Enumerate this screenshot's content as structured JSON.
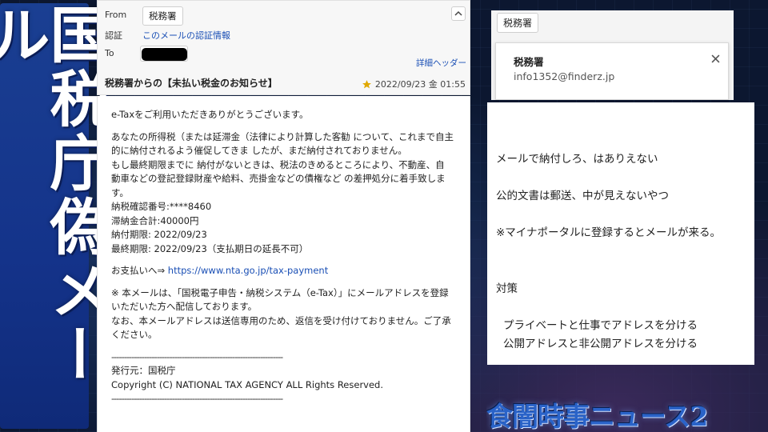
{
  "banner": {
    "text": "国税庁偽メール"
  },
  "mail_header": {
    "from_label": "From",
    "from_value": "税務署",
    "auth_label": "認証",
    "auth_link": "このメールの認証情報",
    "to_label": "To",
    "details_link": "詳細ヘッダー",
    "subject": "税務署からの【未払い税金のお知らせ】",
    "date": "2022/09/23 金 01:55",
    "collapse_icon": "chevron-up-icon",
    "star_icon": "star-icon",
    "star_color": "#e0a800"
  },
  "mail_body": {
    "greeting": "e-Taxをご利用いただきありがとうございます。",
    "para1": "あなたの所得税（または延滞金（法律により計算した客勧 について、これまで自主的に納付されるよう催促してきま したが、まだ納付されておりません。",
    "para2": "もし最終期限までに 納付がないときは、税法のきめるところにより、不動産、自 動車などの登記登録財産や給料、売掛金などの債権など の差押処分に着手致します。",
    "confirm_no": "納税確認番号:****8460",
    "total": "滞納金合計:40000円",
    "due": "納付期限: 2022/09/23",
    "final_due": "最終期限: 2022/09/23（支払期日の延長不可）",
    "pay_prefix": "お支払いへ⇒ ",
    "pay_link": "https://www.nta.go.jp/tax-payment",
    "note1": "※ 本メールは、「国税電子申告・納税システム（e-Tax）」にメールアドレスを登録いただいた方へ配信しております。",
    "note2": "なお、本メールアドレスは送信専用のため、返信を受け付けておりません。ご了承ください。",
    "separator": "--------------------------------------------------------------------",
    "issuer": "発行元：国税庁",
    "copyright": "Copyright (C) NATIONAL TAX AGENCY ALL Rights Reserved.",
    "separator2": "--------------------------------------------------------------------"
  },
  "sender_popup": {
    "chip": "税務署",
    "name": "税務署",
    "email": "info1352@finderz.jp",
    "close_icon": "close-icon"
  },
  "notes": {
    "line1": "メールで納付しろ、はありえない",
    "line2": "公的文書は郵送、中が見えないやつ",
    "line3": "※マイナポータルに登録するとメールが来る。",
    "heading": "対策",
    "tip1": "プライベートと仕事でアドレスを分ける",
    "tip2": "公開アドレスと非公開アドレスを分ける"
  },
  "logo": {
    "text": "食闇時事ニュース2"
  }
}
